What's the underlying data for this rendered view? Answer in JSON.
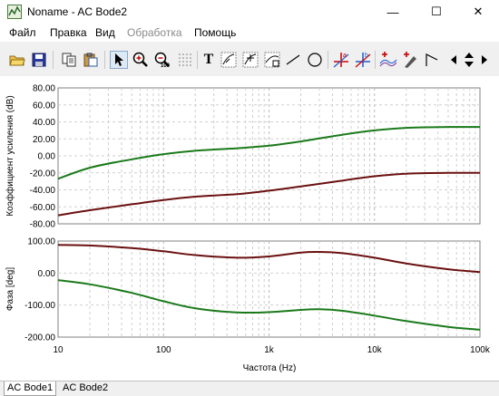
{
  "window": {
    "title": "Noname - AC Bode2",
    "minimize": "—",
    "maximize": "☐",
    "close": "✕"
  },
  "menu": [
    {
      "label": "Файл",
      "enabled": true
    },
    {
      "label": "Правка",
      "enabled": true
    },
    {
      "label": "Вид",
      "enabled": true
    },
    {
      "label": "Обработка",
      "enabled": false
    },
    {
      "label": "Помощь",
      "enabled": true
    }
  ],
  "toolbar": {
    "icons": [
      "open-icon",
      "save-icon",
      "copy-icon",
      "paste-icon",
      "pointer-icon",
      "zoom-in-icon",
      "zoom-out-icon",
      "zoom-100-icon",
      "grid-icon",
      "text-icon",
      "cursor-a-icon",
      "cursor-b-icon",
      "cursor-fit-icon",
      "line-icon",
      "ellipse-icon",
      "marker-a-icon",
      "marker-b-icon",
      "add-marker-icon",
      "add-probe-icon",
      "slope-icon",
      "arrow-left-icon",
      "arrow-updown-icon",
      "arrow-right-icon"
    ],
    "zoom_100_label": "100",
    "text_label": "T",
    "marker_a_label": "a",
    "marker_b_label": "b"
  },
  "chart_data": [
    {
      "type": "line",
      "ylabel": "Коэффициент усиления (dB)",
      "xlabel": "Частота (Hz)",
      "xscale": "log",
      "xlim": [
        10,
        100000
      ],
      "ylim": [
        -80,
        80
      ],
      "x_tick_labels": [
        "10",
        "100",
        "1k",
        "10k",
        "100k"
      ],
      "y_tick_labels": [
        "80.00",
        "60.00",
        "40.00",
        "20.00",
        "0.00",
        "-20.00",
        "-40.00",
        "-60.00",
        "-80.00"
      ],
      "y_ticks": [
        80,
        60,
        40,
        20,
        0,
        -20,
        -40,
        -60,
        -80
      ],
      "grid": true,
      "series": [
        {
          "color": "#1a7a1a",
          "x": [
            10,
            20,
            50,
            100,
            200,
            500,
            1000,
            2000,
            5000,
            10000,
            20000,
            50000,
            100000
          ],
          "values": [
            -27,
            -14,
            -4,
            2,
            6,
            9,
            12,
            17,
            25,
            30,
            33,
            34,
            34
          ]
        },
        {
          "color": "#6b1010",
          "x": [
            10,
            20,
            50,
            100,
            200,
            500,
            1000,
            2000,
            5000,
            10000,
            20000,
            50000,
            100000
          ],
          "values": [
            -70,
            -64,
            -57,
            -52,
            -48,
            -45,
            -41,
            -36,
            -29,
            -24,
            -21,
            -20,
            -20
          ]
        }
      ]
    },
    {
      "type": "line",
      "ylabel": "Фаза [deg]",
      "xlabel": "Частота (Hz)",
      "xscale": "log",
      "xlim": [
        10,
        100000
      ],
      "ylim": [
        -200,
        100
      ],
      "y_tick_labels": [
        "100.00",
        "0.00",
        "-100.00",
        "-200.00"
      ],
      "y_ticks": [
        100,
        0,
        -100,
        -200
      ],
      "grid": true,
      "series": [
        {
          "color": "#6b1010",
          "x": [
            10,
            20,
            50,
            100,
            200,
            500,
            1000,
            2000,
            3000,
            5000,
            10000,
            20000,
            50000,
            100000
          ],
          "values": [
            88,
            86,
            78,
            68,
            56,
            48,
            52,
            64,
            66,
            62,
            48,
            30,
            12,
            3
          ]
        },
        {
          "color": "#1a7a1a",
          "x": [
            10,
            20,
            50,
            100,
            200,
            500,
            1000,
            2000,
            3000,
            5000,
            10000,
            20000,
            50000,
            100000
          ],
          "values": [
            -22,
            -35,
            -62,
            -88,
            -110,
            -123,
            -122,
            -115,
            -113,
            -118,
            -133,
            -150,
            -168,
            -177
          ]
        }
      ]
    }
  ],
  "tabs": [
    {
      "label": "AC Bode1",
      "active": true
    },
    {
      "label": "AC Bode2",
      "active": false
    }
  ]
}
